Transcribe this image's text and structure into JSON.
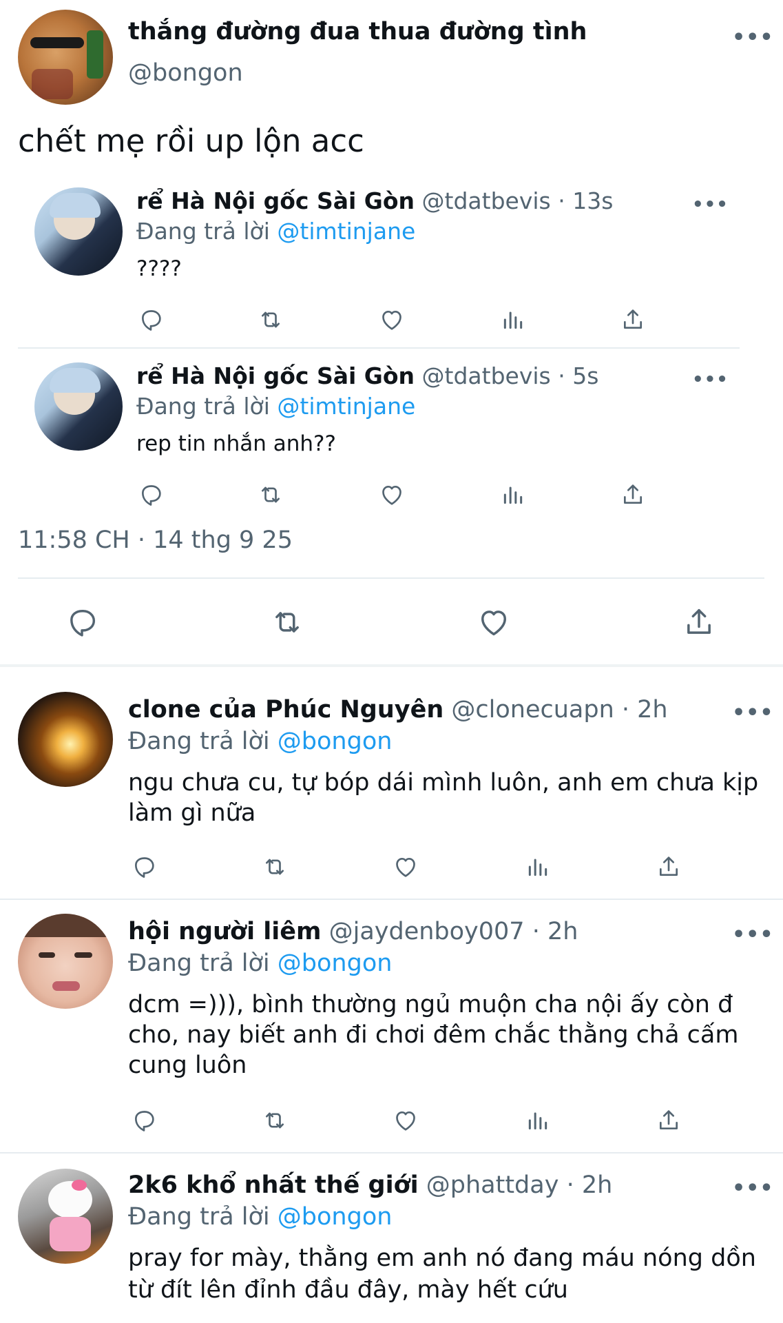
{
  "main_tweet": {
    "display_name": "thắng đường đua thua đường tình",
    "handle": "@bongon",
    "text": "chết mẹ rồi up lộn acc"
  },
  "quoted_replies": [
    {
      "display_name": "rể Hà Nội gốc Sài Gòn",
      "handle": "@tdatbevis",
      "time": "· 13s",
      "replying_prefix": "Đang trả lời",
      "replying_to": "@timtinjane",
      "text": "????"
    },
    {
      "display_name": "rể Hà Nội gốc Sài Gòn",
      "handle": "@tdatbevis",
      "time": "· 5s",
      "replying_prefix": "Đang trả lời",
      "replying_to": "@timtinjane",
      "text": "rep tin nhắn anh??"
    }
  ],
  "timestamp": "11:58 CH · 14 thg 9 25",
  "replies": [
    {
      "display_name": "clone của Phúc Nguyên",
      "handle": "@clonecuapn",
      "time": "· 2h",
      "replying_prefix": "Đang trả lời",
      "replying_to": "@bongon",
      "lines": [
        "ngu chưa cu, tự bóp dái mình luôn, anh em chưa kịp",
        "làm gì nữa"
      ]
    },
    {
      "display_name": "hội người liêm",
      "handle": "@jaydenboy007",
      "time": "· 2h",
      "replying_prefix": "Đang trả lời",
      "replying_to": "@bongon",
      "lines": [
        "dcm =))), bình thường ngủ muộn cha nội ấy còn đ",
        "cho, nay biết anh đi chơi đêm chắc thằng chả cấm",
        "cung luôn"
      ]
    },
    {
      "display_name": "2k6 khổ nhất thế giới",
      "handle": "@phattday",
      "time": "· 2h",
      "replying_prefix": "Đang trả lời",
      "replying_to": "@bongon",
      "lines": [
        "pray for mày, thằng em anh nó đang máu nóng dồn",
        "từ đít lên đỉnh đầu đây, mày hết cứu"
      ]
    }
  ],
  "icons": {
    "reply": "reply-icon",
    "retweet": "retweet-icon",
    "like": "like-icon",
    "views": "views-icon",
    "share": "share-icon",
    "more": "more-icon"
  },
  "colors": {
    "mention": "#1d9bf0",
    "secondary_text": "#536471",
    "divider": "#e6ecf0"
  }
}
